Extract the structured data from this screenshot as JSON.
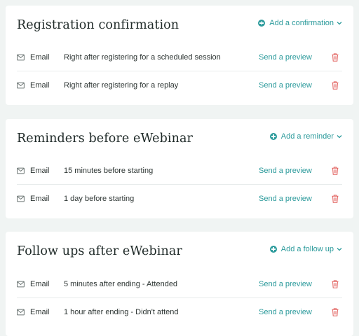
{
  "sections": [
    {
      "title": "Registration confirmation",
      "add_label": "Add a confirmation",
      "rows": [
        {
          "channel": "Email",
          "description": "Right after registering for a scheduled session",
          "preview_label": "Send a preview"
        },
        {
          "channel": "Email",
          "description": "Right after registering for a replay",
          "preview_label": "Send a preview"
        }
      ]
    },
    {
      "title": "Reminders before eWebinar",
      "add_label": "Add a reminder",
      "rows": [
        {
          "channel": "Email",
          "description": "15 minutes before starting",
          "preview_label": "Send a preview"
        },
        {
          "channel": "Email",
          "description": "1 day before starting",
          "preview_label": "Send a preview"
        }
      ]
    },
    {
      "title": "Follow ups after eWebinar",
      "add_label": "Add a follow up",
      "rows": [
        {
          "channel": "Email",
          "description": "5 minutes after ending - Attended",
          "preview_label": "Send a preview"
        },
        {
          "channel": "Email",
          "description": "1 hour after ending - Didn't attend",
          "preview_label": "Send a preview"
        }
      ]
    }
  ],
  "colors": {
    "background": "#f0f4f3",
    "accent": "#2b9a9b",
    "delete": "#e2625f",
    "text": "#2d3533"
  },
  "icons": {
    "add": "plus-circle-icon",
    "dropdown": "chevron-down-icon",
    "channel": "mail-icon",
    "delete": "trash-icon"
  }
}
